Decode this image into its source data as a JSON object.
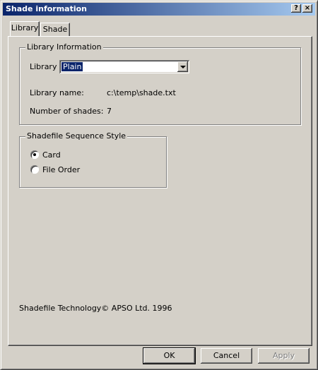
{
  "window": {
    "title": "Shade information",
    "help_label": "?",
    "close_label": "×"
  },
  "tabs": [
    {
      "label": "Library",
      "active": true
    },
    {
      "label": "Shade",
      "active": false
    }
  ],
  "library_info": {
    "group_title": "Library Information",
    "library_label": "Library",
    "library_value": "Plain",
    "name_label": "Library name:",
    "name_value": "c:\\temp\\shade.txt",
    "count_label": "Number of shades:",
    "count_value": "7"
  },
  "sequence": {
    "group_title": "Shadefile Sequence Style",
    "options": [
      {
        "label": "Card",
        "selected": true
      },
      {
        "label": "File Order",
        "selected": false
      }
    ]
  },
  "footer_text": "Shadefile Technology© APSO Ltd. 1996",
  "buttons": {
    "ok": "OK",
    "cancel": "Cancel",
    "apply": "Apply"
  }
}
